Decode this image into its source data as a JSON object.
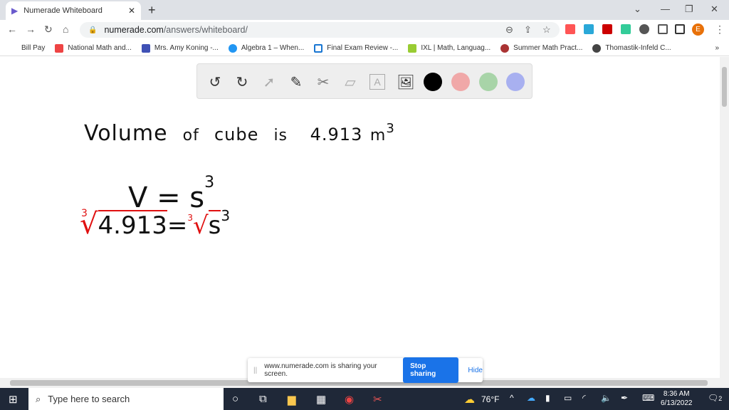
{
  "browser": {
    "tab_title": "Numerade Whiteboard",
    "url_domain": "numerade.com",
    "url_path": "/answers/whiteboard/",
    "profile_initial": "E",
    "bookmarks": [
      "Bill Pay",
      "National Math and...",
      "Mrs. Amy Koning -...",
      "Algebra 1 – When...",
      "Final Exam Review -...",
      "IXL | Math, Languag...",
      "Summer Math Pract...",
      "Thomastik-Infeld C..."
    ],
    "bookmarks_more": "»"
  },
  "colors": {
    "black": "#000000",
    "pink": "#f0a8a8",
    "green": "#a8d4a8",
    "purple": "#a8b0f0",
    "accent": "#1a73e8"
  },
  "whiteboard": {
    "line1_words": [
      "Volume",
      "of",
      "cube",
      "is",
      "4.913",
      "m"
    ],
    "line1_exp": "3",
    "eq1_left": "V = s",
    "eq1_exp": "3",
    "root_index": "3",
    "eq2_left": "4.913",
    "eq2_eq": "=",
    "eq2_right": "s",
    "eq2_exp": "3"
  },
  "share_bar": {
    "message": "www.numerade.com is sharing your screen.",
    "stop": "Stop sharing",
    "hide": "Hide"
  },
  "taskbar": {
    "search_placeholder": "Type here to search",
    "weather": "76°F",
    "time": "8:36 AM",
    "date": "6/13/2022",
    "notifications": "2"
  }
}
